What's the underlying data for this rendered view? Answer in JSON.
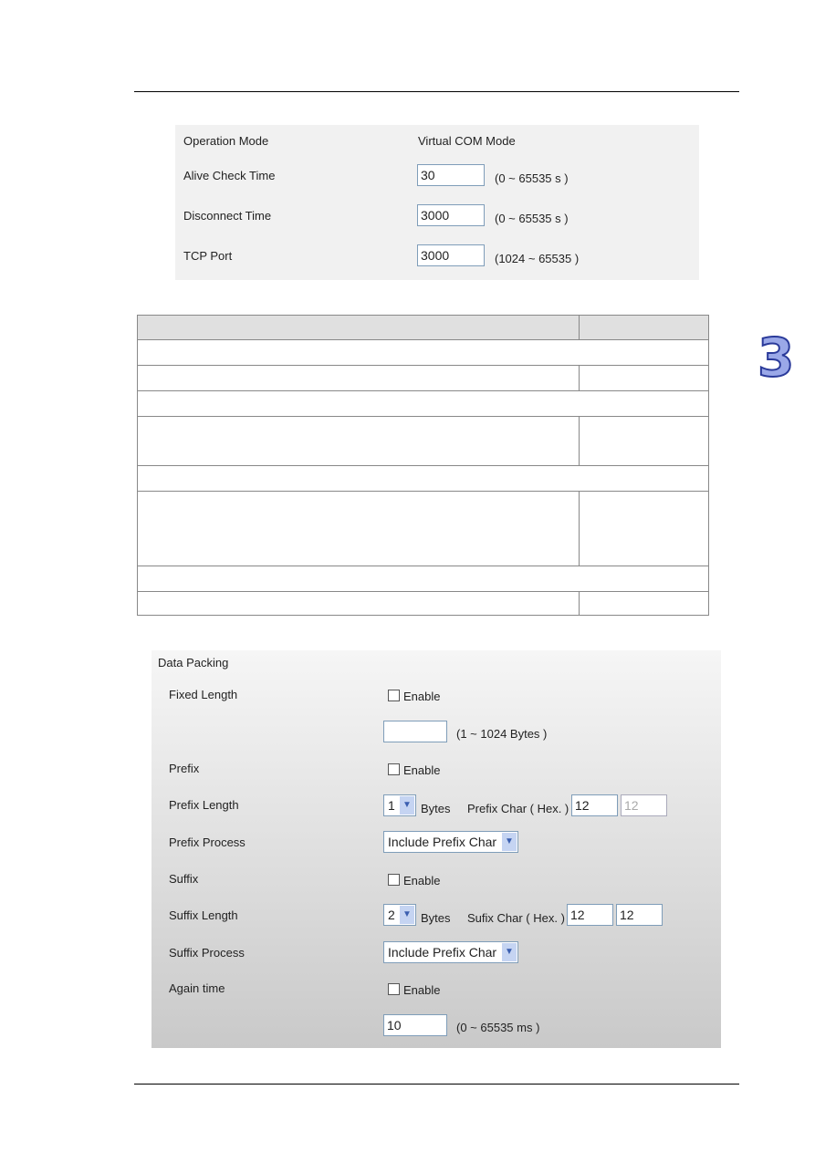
{
  "chapter_tab": "3",
  "panel1": {
    "operation_mode_label": "Operation Mode",
    "operation_mode_value": "Virtual COM Mode",
    "alive_check_label": "Alive Check Time",
    "alive_check_value": "30",
    "alive_check_range": "(0 ~ 65535 s )",
    "disconnect_label": "Disconnect Time",
    "disconnect_value": "3000",
    "disconnect_range": "(0 ~ 65535 s )",
    "tcp_port_label": "TCP Port",
    "tcp_port_value": "3000",
    "tcp_port_range": "(1024 ~ 65535 )"
  },
  "panel2": {
    "title": "Data Packing",
    "fixed_length_label": "Fixed Length",
    "fixed_length_enable": "Enable",
    "fixed_length_value": "",
    "fixed_length_range": "(1 ~ 1024 Bytes )",
    "prefix_label": "Prefix",
    "prefix_enable": "Enable",
    "prefix_length_label": "Prefix Length",
    "prefix_length_value": "1",
    "bytes": "Bytes",
    "prefix_char_label": "Prefix Char ( Hex. )",
    "prefix_char_1": "12",
    "prefix_char_2": "12",
    "prefix_process_label": "Prefix Process",
    "prefix_process_value": "Include Prefix Char",
    "suffix_label": "Suffix",
    "suffix_enable": "Enable",
    "suffix_length_label": "Suffix Length",
    "suffix_length_value": "2",
    "suffix_char_label": "Sufix Char ( Hex. )",
    "suffix_char_1": "12",
    "suffix_char_2": "12",
    "suffix_process_label": "Suffix Process",
    "suffix_process_value": "Include Prefix Char",
    "again_time_label": "Again time",
    "again_time_enable": "Enable",
    "again_time_value": "10",
    "again_time_range": "(0 ~ 65535 ms )"
  }
}
